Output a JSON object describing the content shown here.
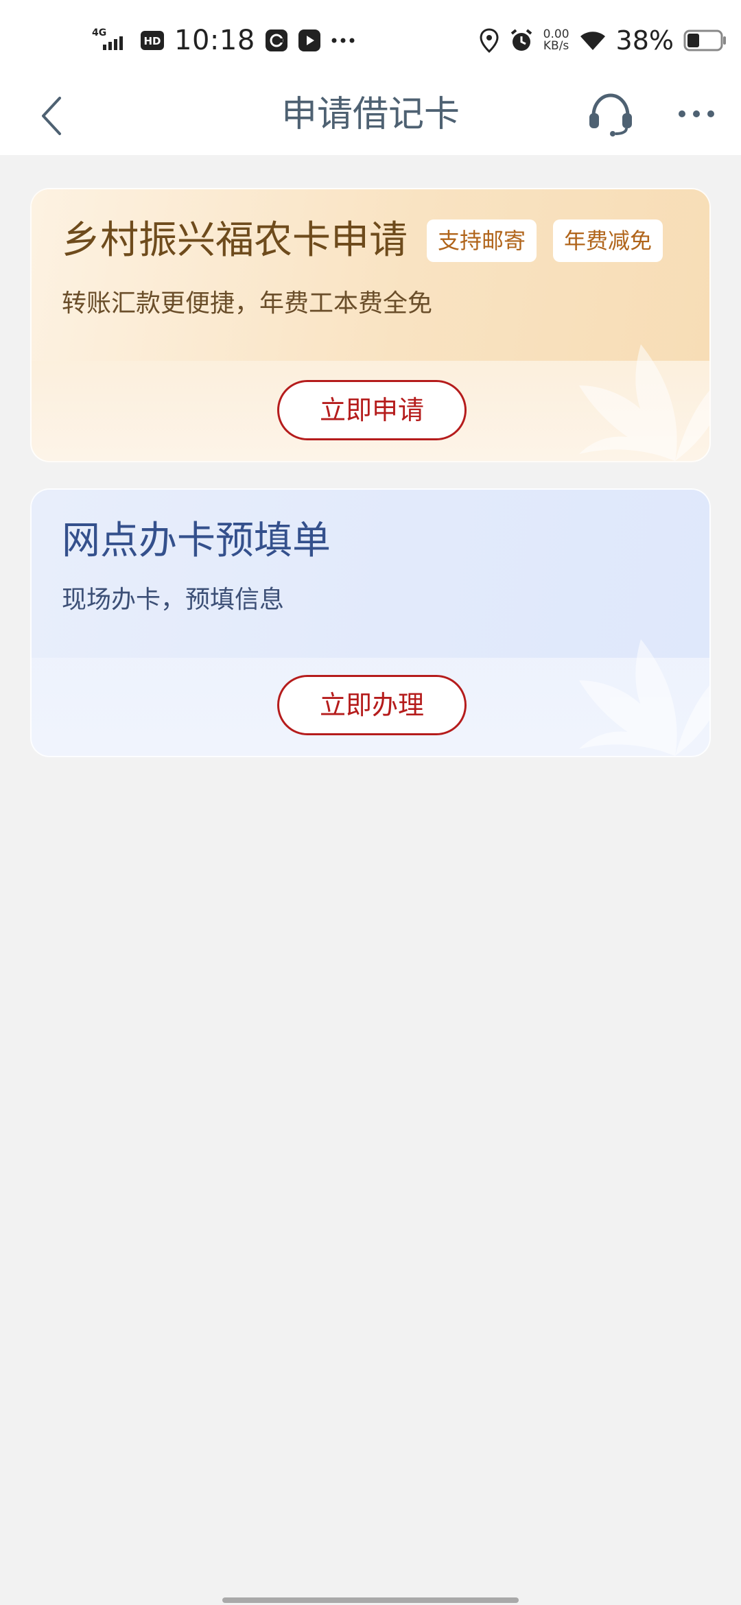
{
  "status_bar": {
    "network": "4G",
    "hd": "HD",
    "time": "10:18",
    "speed_value": "0.00",
    "speed_unit": "KB/s",
    "battery_percent": "38%",
    "battery_level": 0.38
  },
  "header": {
    "title": "申请借记卡",
    "back_icon": "chevron-left-icon",
    "support_icon": "headset-icon",
    "more_icon": "more-dots-icon"
  },
  "cards": [
    {
      "title": "乡村振兴福农卡申请",
      "tags": [
        "支持邮寄",
        "年费减免"
      ],
      "subtitle": "转账汇款更便捷，年费工本费全免",
      "button_label": "立即申请",
      "theme_color": "#6e4b1c"
    },
    {
      "title": "网点办卡预填单",
      "subtitle": "现场办卡，预填信息",
      "button_label": "立即办理",
      "theme_color": "#34508c"
    }
  ],
  "colors": {
    "accent_red": "#b51c1c",
    "header_text": "#4e6172",
    "page_background": "#f2f2f2"
  }
}
